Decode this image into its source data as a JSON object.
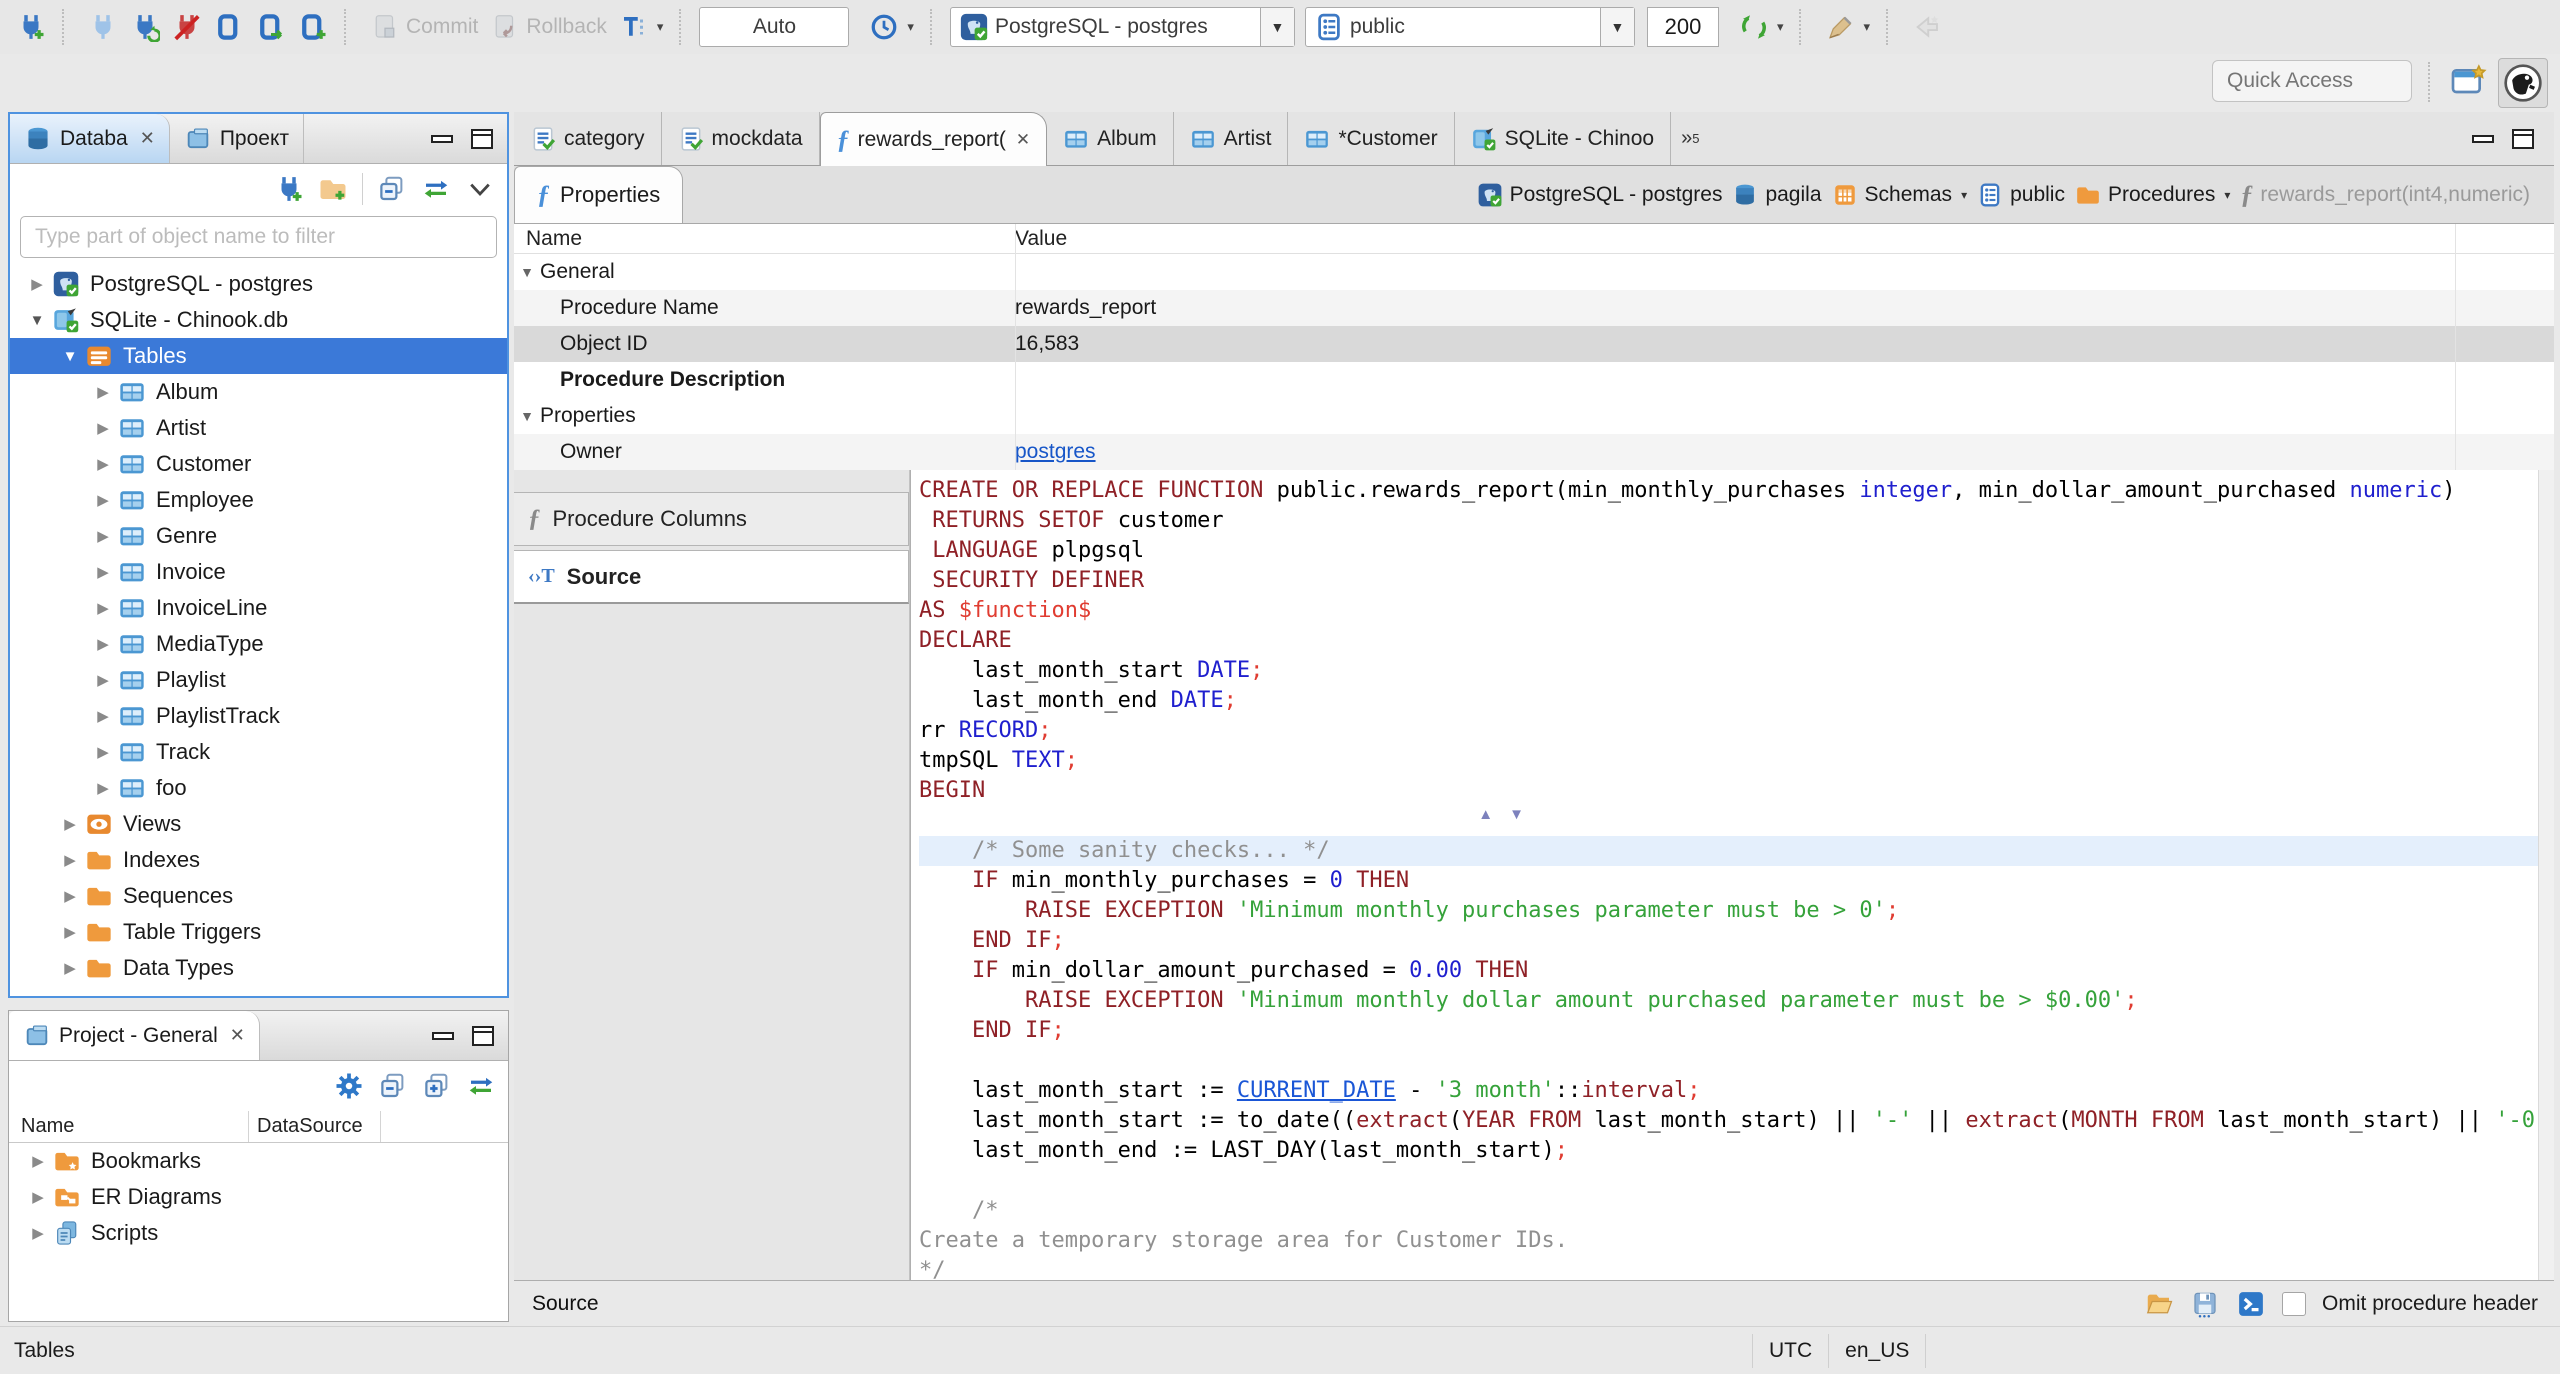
{
  "toolbar": {
    "commit_label": "Commit",
    "rollback_label": "Rollback",
    "auto_value": "Auto",
    "connection_value": "PostgreSQL - postgres",
    "schema_value": "public",
    "fetch_size_value": "200",
    "quick_access_placeholder": "Quick Access"
  },
  "navigator": {
    "tab_database": "Databa",
    "tab_project": "Проект",
    "filter_placeholder": "Type part of object name to filter",
    "tree": [
      {
        "d": 0,
        "a": "c",
        "i": "postgresql",
        "t": "PostgreSQL - postgres"
      },
      {
        "d": 0,
        "a": "e",
        "i": "sqlite",
        "t": "SQLite - Chinook.db"
      },
      {
        "d": 1,
        "a": "e",
        "i": "tables-folder",
        "t": "Tables",
        "sel": true
      },
      {
        "d": 2,
        "a": "c",
        "i": "table",
        "t": "Album"
      },
      {
        "d": 2,
        "a": "c",
        "i": "table",
        "t": "Artist"
      },
      {
        "d": 2,
        "a": "c",
        "i": "table",
        "t": "Customer"
      },
      {
        "d": 2,
        "a": "c",
        "i": "table",
        "t": "Employee"
      },
      {
        "d": 2,
        "a": "c",
        "i": "table",
        "t": "Genre"
      },
      {
        "d": 2,
        "a": "c",
        "i": "table",
        "t": "Invoice"
      },
      {
        "d": 2,
        "a": "c",
        "i": "table",
        "t": "InvoiceLine"
      },
      {
        "d": 2,
        "a": "c",
        "i": "table",
        "t": "MediaType"
      },
      {
        "d": 2,
        "a": "c",
        "i": "table",
        "t": "Playlist"
      },
      {
        "d": 2,
        "a": "c",
        "i": "table",
        "t": "PlaylistTrack"
      },
      {
        "d": 2,
        "a": "c",
        "i": "table",
        "t": "Track"
      },
      {
        "d": 2,
        "a": "c",
        "i": "table",
        "t": "foo"
      },
      {
        "d": 1,
        "a": "c",
        "i": "views",
        "t": "Views"
      },
      {
        "d": 1,
        "a": "c",
        "i": "folder",
        "t": "Indexes"
      },
      {
        "d": 1,
        "a": "c",
        "i": "folder",
        "t": "Sequences"
      },
      {
        "d": 1,
        "a": "c",
        "i": "folder",
        "t": "Table Triggers"
      },
      {
        "d": 1,
        "a": "c",
        "i": "folder",
        "t": "Data Types"
      }
    ]
  },
  "project": {
    "title": "Project - General",
    "columns": [
      "Name",
      "DataSource"
    ],
    "rows": [
      {
        "i": "bookmarks-folder",
        "t": "Bookmarks"
      },
      {
        "i": "er-diagrams-folder",
        "t": "ER Diagrams"
      },
      {
        "i": "scripts",
        "t": "Scripts"
      }
    ],
    "status": "Tables"
  },
  "editor": {
    "tabs": [
      {
        "i": "sql-script",
        "t": "category"
      },
      {
        "i": "sql-script",
        "t": "mockdata"
      },
      {
        "i": "function",
        "t": "rewards_report(",
        "active": true,
        "close": true
      },
      {
        "i": "table",
        "t": "Album"
      },
      {
        "i": "table",
        "t": "Artist"
      },
      {
        "i": "table",
        "t": "*Customer"
      },
      {
        "i": "sqlite",
        "t": "SQLite - Chinoo"
      }
    ],
    "overflow_count": "5",
    "properties_tab": "Properties",
    "breadcrumb": [
      {
        "i": "postgresql",
        "t": "PostgreSQL - postgres"
      },
      {
        "i": "database",
        "t": "pagila"
      },
      {
        "i": "schemas",
        "t": "Schemas",
        "dd": true
      },
      {
        "i": "schema",
        "t": "public"
      },
      {
        "i": "folder",
        "t": "Procedures",
        "dd": true
      },
      {
        "i": "function",
        "t": "rewards_report(int4,numeric)",
        "dim": true
      }
    ],
    "subtabs": [
      {
        "i": "function",
        "t": "Procedure Columns"
      },
      {
        "i": "source",
        "t": "Source",
        "active": true
      }
    ],
    "bottom_label": "Source",
    "omit_label": "Omit procedure header"
  },
  "properties_grid": {
    "columns": [
      "Name",
      "Value"
    ],
    "rows": [
      {
        "type": "group",
        "name": "General"
      },
      {
        "type": "item",
        "name": "Procedure Name",
        "value": "rewards_report",
        "alt": true
      },
      {
        "type": "item",
        "name": "Object ID",
        "value": "16,583",
        "selected": true
      },
      {
        "type": "item",
        "name": "Procedure Description",
        "value": "",
        "bold": true
      },
      {
        "type": "group",
        "name": "Properties"
      },
      {
        "type": "item",
        "name": "Owner",
        "value": "postgres",
        "link": true,
        "alt": true
      }
    ]
  },
  "source": {
    "lines": [
      {
        "seg": [
          [
            "c-kw",
            "CREATE OR REPLACE FUNCTION "
          ],
          [
            "c-pl",
            "public.rewards_report(min_monthly_purchases "
          ],
          [
            "c-typ",
            "integer"
          ],
          [
            "c-pl",
            ", min_dollar_amount_purchased "
          ],
          [
            "c-typ",
            "numeric"
          ],
          [
            "c-pl",
            ")"
          ]
        ]
      },
      {
        "seg": [
          [
            "c-kw",
            " RETURNS SETOF "
          ],
          [
            "c-pl",
            "customer"
          ]
        ]
      },
      {
        "seg": [
          [
            "c-kw",
            " LANGUAGE "
          ],
          [
            "c-pl",
            "plpgsql"
          ]
        ]
      },
      {
        "seg": [
          [
            "c-kw",
            " SECURITY DEFINER"
          ]
        ]
      },
      {
        "seg": [
          [
            "c-kw",
            "AS "
          ],
          [
            "c-dol",
            "$function$"
          ]
        ]
      },
      {
        "seg": [
          [
            "c-kw",
            "DECLARE"
          ]
        ]
      },
      {
        "seg": [
          [
            "c-pl",
            "    last_month_start "
          ],
          [
            "c-typ",
            "DATE"
          ],
          [
            "c-pun",
            ";"
          ]
        ]
      },
      {
        "seg": [
          [
            "c-pl",
            "    last_month_end "
          ],
          [
            "c-typ",
            "DATE"
          ],
          [
            "c-pun",
            ";"
          ]
        ]
      },
      {
        "seg": [
          [
            "c-pl",
            "rr "
          ],
          [
            "c-typ",
            "RECORD"
          ],
          [
            "c-pun",
            ";"
          ]
        ]
      },
      {
        "seg": [
          [
            "c-pl",
            "tmpSQL "
          ],
          [
            "c-typ",
            "TEXT"
          ],
          [
            "c-pun",
            ";"
          ]
        ]
      },
      {
        "seg": [
          [
            "c-kw",
            "BEGIN"
          ]
        ]
      },
      {
        "seg": []
      },
      {
        "hl": true,
        "seg": [
          [
            "c-com",
            "    /* Some sanity checks... */"
          ]
        ]
      },
      {
        "seg": [
          [
            "c-pl",
            "    "
          ],
          [
            "c-kw",
            "IF "
          ],
          [
            "c-pl",
            "min_monthly_purchases = "
          ],
          [
            "c-num",
            "0"
          ],
          [
            "c-kw",
            " THEN"
          ]
        ]
      },
      {
        "seg": [
          [
            "c-pl",
            "        "
          ],
          [
            "c-kw",
            "RAISE EXCEPTION "
          ],
          [
            "c-str",
            "'Minimum monthly purchases parameter must be > 0'"
          ],
          [
            "c-pun",
            ";"
          ]
        ]
      },
      {
        "seg": [
          [
            "c-pl",
            "    "
          ],
          [
            "c-kw",
            "END IF"
          ],
          [
            "c-pun",
            ";"
          ]
        ]
      },
      {
        "seg": [
          [
            "c-pl",
            "    "
          ],
          [
            "c-kw",
            "IF "
          ],
          [
            "c-pl",
            "min_dollar_amount_purchased = "
          ],
          [
            "c-num",
            "0.00"
          ],
          [
            "c-kw",
            " THEN"
          ]
        ]
      },
      {
        "seg": [
          [
            "c-pl",
            "        "
          ],
          [
            "c-kw",
            "RAISE EXCEPTION "
          ],
          [
            "c-str",
            "'Minimum monthly dollar amount purchased parameter must be > $0.00'"
          ],
          [
            "c-pun",
            ";"
          ]
        ]
      },
      {
        "seg": [
          [
            "c-pl",
            "    "
          ],
          [
            "c-kw",
            "END IF"
          ],
          [
            "c-pun",
            ";"
          ]
        ]
      },
      {
        "seg": []
      },
      {
        "seg": [
          [
            "c-pl",
            "    last_month_start := "
          ],
          [
            "c-lnk",
            "CURRENT_DATE"
          ],
          [
            "c-pl",
            " - "
          ],
          [
            "c-str",
            "'3 month'"
          ],
          [
            "c-pl",
            "::"
          ],
          [
            "c-kw",
            "interval"
          ],
          [
            "c-pun",
            ";"
          ]
        ]
      },
      {
        "seg": [
          [
            "c-pl",
            "    last_month_start := to_date(("
          ],
          [
            "c-kw",
            "extract"
          ],
          [
            "c-pl",
            "("
          ],
          [
            "c-kw",
            "YEAR FROM"
          ],
          [
            "c-pl",
            " last_month_start) || "
          ],
          [
            "c-str",
            "'-'"
          ],
          [
            "c-pl",
            " || "
          ],
          [
            "c-kw",
            "extract"
          ],
          [
            "c-pl",
            "("
          ],
          [
            "c-kw",
            "MONTH FROM"
          ],
          [
            "c-pl",
            " last_month_start) || "
          ],
          [
            "c-str",
            "'-0"
          ]
        ]
      },
      {
        "seg": [
          [
            "c-pl",
            "    last_month_end := LAST_DAY(last_month_start)"
          ],
          [
            "c-pun",
            ";"
          ]
        ]
      },
      {
        "seg": []
      },
      {
        "seg": [
          [
            "c-com",
            "    /*"
          ]
        ]
      },
      {
        "seg": [
          [
            "c-com",
            "Create a temporary storage area for Customer IDs."
          ]
        ]
      },
      {
        "seg": [
          [
            "c-com",
            "*/"
          ]
        ]
      }
    ]
  },
  "statusbar": {
    "left": "Tables",
    "timezone": "UTC",
    "locale": "en_US"
  },
  "colors": {
    "selection_blue": "#3b79d8",
    "focus_border": "#4f93e0",
    "link_blue": "#1756c8",
    "icon_orange": "#ef9a3d",
    "icon_blue": "#4b97d2",
    "code_keyword": "#8f2026",
    "code_string": "#35a23a",
    "code_number": "#1f1fce",
    "code_comment": "#909090",
    "code_dollar_quote": "#e03c31",
    "line_highlight": "#e4effc"
  }
}
